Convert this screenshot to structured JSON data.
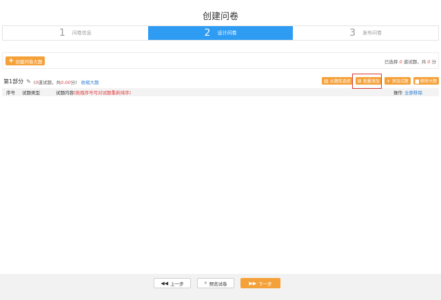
{
  "page": {
    "title": "创建问卷"
  },
  "steps": [
    {
      "num": "1",
      "label": "问卷信息",
      "active": false
    },
    {
      "num": "2",
      "label": "设计问卷",
      "active": true
    },
    {
      "num": "3",
      "label": "发布问卷",
      "active": false
    }
  ],
  "toolbar": {
    "create_label": "创建问卷大题",
    "selected_prefix": "已选择",
    "selected_count": "0",
    "selected_mid": "道试题，共",
    "selected_score": "0",
    "selected_suffix": "分"
  },
  "section": {
    "title": "第1部分",
    "meta_open": "(",
    "meta_count": "0",
    "meta_mid": "道试题，共",
    "meta_score": "0.00",
    "meta_close": "分)",
    "collapse_label": "收缩大题",
    "actions": {
      "from_bank": "从题库选择",
      "batch_add": "批量添加",
      "add_question": "添加试题",
      "remove_section": "移除大题"
    }
  },
  "table": {
    "col_seq": "序号",
    "col_type": "试题类型",
    "col_content": "试题内容",
    "col_content_hint": "(拖拽序号可对试题重新排序)",
    "col_op": "操作",
    "remove_all": "全部移除"
  },
  "footer": {
    "prev": "上一步",
    "preview": "预览试卷",
    "next": "下一步"
  },
  "colors": {
    "accent_blue": "#2f9cf4",
    "accent_orange": "#f5a13a",
    "highlight_red": "#d9342b"
  }
}
